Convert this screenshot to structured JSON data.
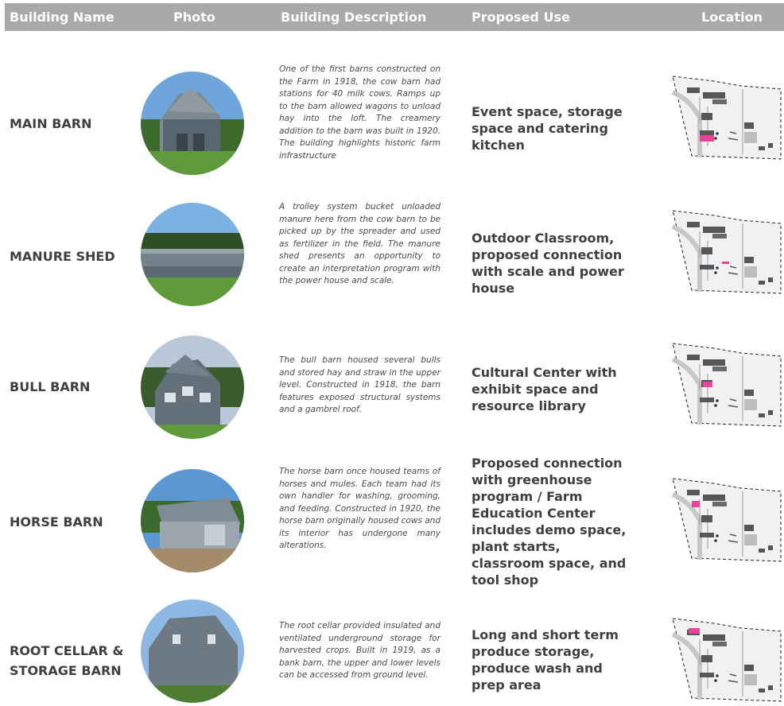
{
  "header": {
    "building_name": "Building Name",
    "photo": "Photo",
    "building_description": "Building Description",
    "proposed_use": "Proposed Use",
    "location": "Location"
  },
  "rows": [
    {
      "name": "MAIN BARN",
      "description": "One of the first barns constructed on the Farm in 1918, the cow barn had stations for 40 milk cows. Ramps up to the barn allowed wagons to unload hay into the loft. The creamery addition to the barn was built in 1920. The building highlights historic farm infrastructure",
      "proposed_use": "Event space, storage space and catering kitchen"
    },
    {
      "name": "MANURE SHED",
      "description": "A trolley system bucket unloaded manure here from the cow barn to be picked up by the spreader and used as fertilizer in the field. The manure shed presents an opportunity to create an interpretation program with the power house and scale.",
      "proposed_use": "Outdoor Classroom, proposed connection with scale and power house"
    },
    {
      "name": "BULL BARN",
      "description": "The bull barn housed several bulls and stored hay and straw in the upper level. Constructed in 1918, the barn features exposed structural systems and a gambrel roof.",
      "proposed_use": "Cultural Center with exhibit space and resource library"
    },
    {
      "name": "HORSE BARN",
      "description": "The horse barn once housed teams of horses and mules. Each team had its own handler for washing, grooming, and feeding. Constructed in 1920, the horse barn originally housed cows and its interior has undergone many alterations.",
      "proposed_use": "Proposed connection with greenhouse program / Farm Education Center includes demo space, plant starts, classroom space, and tool shop"
    },
    {
      "name": "ROOT CELLAR & STORAGE BARN",
      "description": "The root cellar provided insulated and ventilated underground storage for harvested crops. Built in 1919, as a bank barn, the upper and lower levels can be accessed from ground level.",
      "proposed_use": "Long and short term produce storage, produce wash and prep area"
    }
  ],
  "colors": {
    "header_bg": "#a9a9a9",
    "header_text": "#ffffff",
    "highlight": "#e8449a",
    "barn_gray": "#5e6770",
    "grass": "#5f8f3a",
    "sky": "#cfe0f2"
  }
}
